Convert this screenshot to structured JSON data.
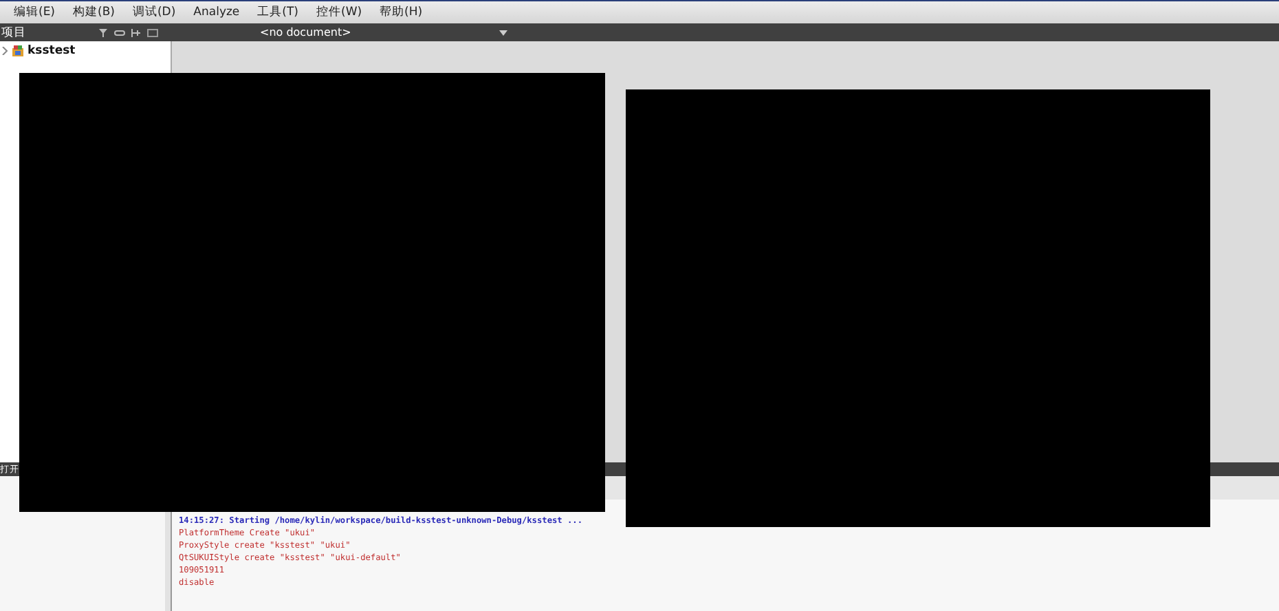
{
  "menu": [
    {
      "label": "编辑(E)"
    },
    {
      "label": "构建(B)"
    },
    {
      "label": "调试(D)"
    },
    {
      "label": "Analyze"
    },
    {
      "label": "工具(T)"
    },
    {
      "label": "控件(W)"
    },
    {
      "label": "帮助(H)"
    }
  ],
  "projects_panel": {
    "title": "项目",
    "tree": [
      {
        "label": "ksstest",
        "expanded": false
      }
    ]
  },
  "editor": {
    "document": "<no document>"
  },
  "bottom_panel": {
    "title": "打开"
  },
  "output": {
    "lines": [
      {
        "kind": "info",
        "text": "14:15:27: Starting /home/kylin/workspace/build-ksstest-unknown-Debug/ksstest ..."
      },
      {
        "kind": "error",
        "text": "PlatformTheme Create \"ukui\""
      },
      {
        "kind": "error",
        "text": "ProxyStyle create \"ksstest\" \"ukui\""
      },
      {
        "kind": "error",
        "text": "QtSUKUIStyle create \"ksstest\" \"ukui-default\""
      },
      {
        "kind": "error",
        "text": "109051911"
      },
      {
        "kind": "error",
        "text": "disable"
      }
    ]
  }
}
